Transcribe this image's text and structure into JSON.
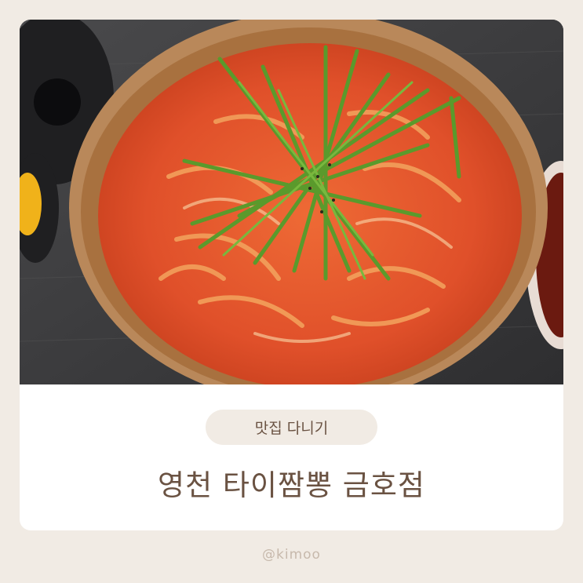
{
  "photo": {
    "description_icon": "jjamppong-noodle-soup-bowl-icon"
  },
  "tag": {
    "label": "맛집 다니기"
  },
  "title": {
    "text": "영천 타이짬뽕 금호점"
  },
  "credit": {
    "text": "@kimoo"
  },
  "colors": {
    "page_bg": "#f1ebe4",
    "text_brown": "#6a5242",
    "soup_red": "#d94a22",
    "chive_green": "#5a9a2c"
  }
}
